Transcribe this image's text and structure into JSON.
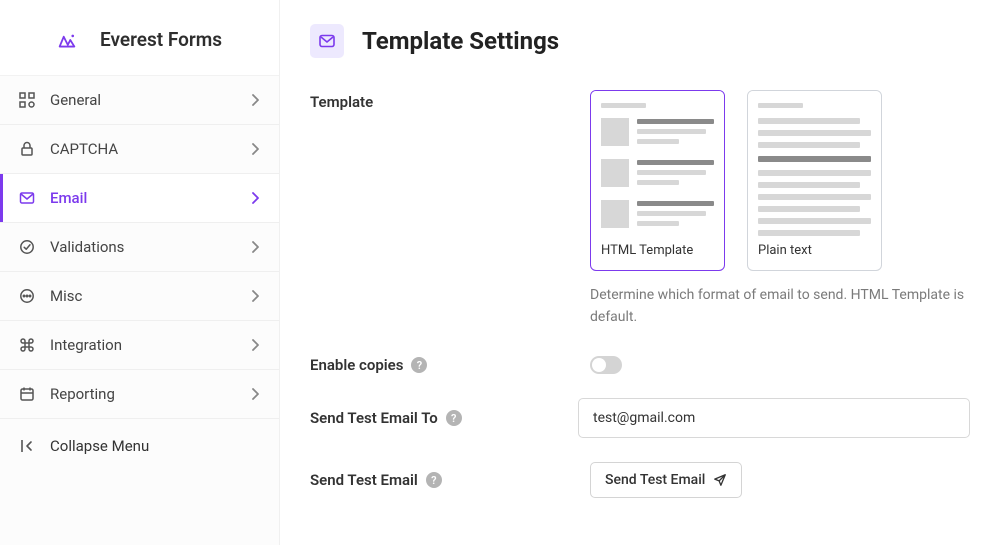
{
  "brand": {
    "name": "Everest Forms"
  },
  "sidebar": {
    "items": [
      {
        "id": "general",
        "label": "General"
      },
      {
        "id": "captcha",
        "label": "CAPTCHA"
      },
      {
        "id": "email",
        "label": "Email"
      },
      {
        "id": "validations",
        "label": "Validations"
      },
      {
        "id": "misc",
        "label": "Misc"
      },
      {
        "id": "integration",
        "label": "Integration"
      },
      {
        "id": "reporting",
        "label": "Reporting"
      }
    ],
    "active": "email",
    "collapse_label": "Collapse Menu"
  },
  "page": {
    "title": "Template Settings"
  },
  "settings": {
    "template": {
      "label": "Template",
      "options": [
        {
          "id": "html",
          "label": "HTML Template"
        },
        {
          "id": "plain",
          "label": "Plain text"
        }
      ],
      "selected": "html",
      "desc": "Determine which format of email to send. HTML Template is default."
    },
    "enable_copies": {
      "label": "Enable copies",
      "value": false
    },
    "send_test_to": {
      "label": "Send Test Email To",
      "value": "test@gmail.com"
    },
    "send_test": {
      "label": "Send Test Email",
      "button": "Send Test Email"
    }
  }
}
